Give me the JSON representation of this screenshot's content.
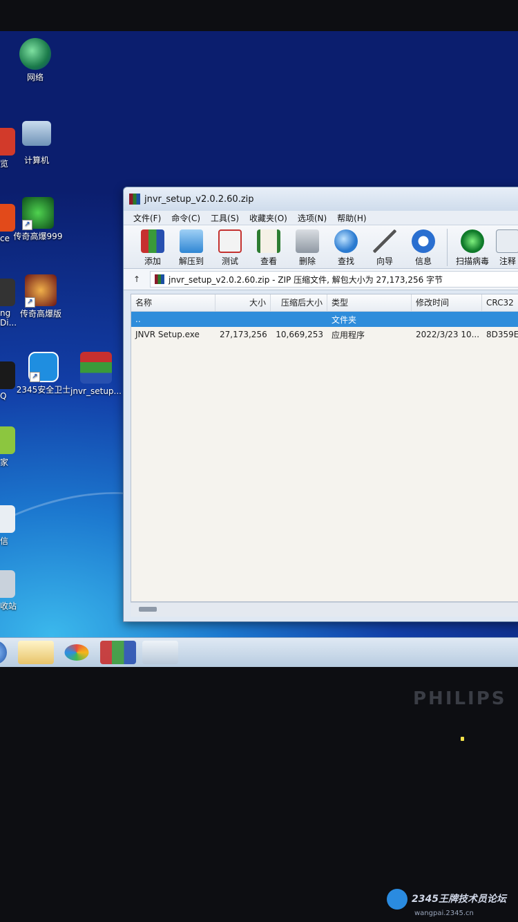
{
  "desktop": {
    "icons": [
      {
        "label": "网络"
      },
      {
        "label": "计算机"
      },
      {
        "label": "传奇高爆999"
      },
      {
        "label": "传奇高爆版"
      },
      {
        "label": "2345安全卫士"
      },
      {
        "label": "jnvr_setup..."
      }
    ],
    "partial_labels": [
      "览",
      "ce",
      "ng",
      "Di...",
      "Q",
      "家",
      "信",
      "收站"
    ]
  },
  "window": {
    "title": "jnvr_setup_v2.0.2.60.zip",
    "menu": [
      "文件(F)",
      "命令(C)",
      "工具(S)",
      "收藏夹(O)",
      "选项(N)",
      "帮助(H)"
    ],
    "toolbar": [
      "添加",
      "解压到",
      "测试",
      "查看",
      "删除",
      "查找",
      "向导",
      "信息",
      "扫描病毒",
      "注释"
    ],
    "address": "jnvr_setup_v2.0.2.60.zip - ZIP 压缩文件, 解包大小为 27,173,256 字节",
    "columns": [
      "名称",
      "大小",
      "压缩后大小",
      "类型",
      "修改时间",
      "CRC32"
    ],
    "rows": [
      {
        "name": "..",
        "size": "",
        "packed": "",
        "type": "文件夹",
        "modified": "",
        "crc": ""
      },
      {
        "name": "JNVR Setup.exe",
        "size": "27,173,256",
        "packed": "10,669,253",
        "type": "应用程序",
        "modified": "2022/3/23 10...",
        "crc": "8D359E"
      }
    ]
  },
  "monitor": {
    "brand": "PHILIPS"
  },
  "watermark": {
    "text": "2345王牌技术员论坛",
    "url": "wangpai.2345.cn"
  }
}
